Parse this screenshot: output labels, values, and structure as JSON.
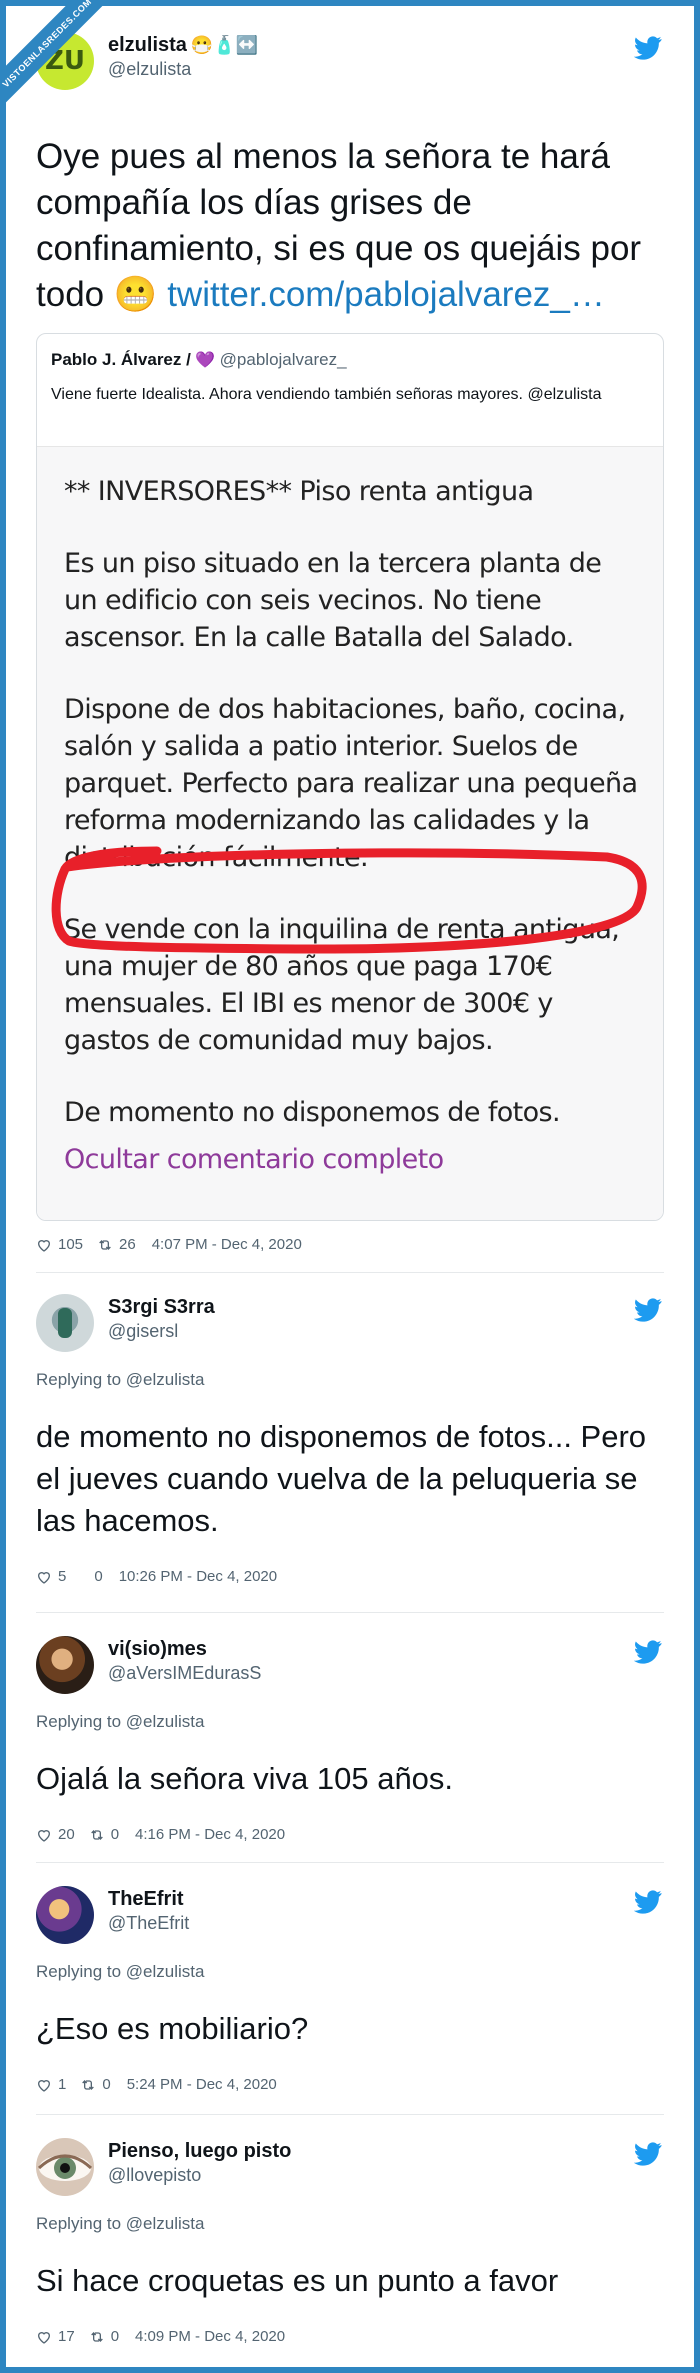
{
  "watermark": "VISTOENLASREDES.COM",
  "main_tweet": {
    "display_name": "elzulista",
    "name_emojis": "😷🧴↔️",
    "handle": "@elzulista",
    "avatar_text": "ZU",
    "text": "Oye pues al menos la señora te hará compañía los días grises de confinamiento, si es que os quejáis por todo",
    "text_emoji": "😬",
    "link": "twitter.com/pablojalvarez_…",
    "likes": "105",
    "retweets": "26",
    "timestamp": "4:07 PM - Dec 4, 2020"
  },
  "quote": {
    "display_name": "Pablo J. Álvarez /",
    "name_emoji": "💜",
    "handle": "@pablojalvarez_",
    "text": "Viene fuerte Idealista. Ahora vendiendo también señoras mayores. @elzulista",
    "ad_paragraphs": [
      "** INVERSORES** Piso renta antigua",
      "Es un piso situado en la tercera planta de un edificio con seis vecinos. No tiene ascensor. En la calle Batalla del Salado.",
      "Dispone de dos habitaciones, baño, cocina, salón y salida a patio interior. Suelos de parquet. Perfecto para realizar una pequeña reforma modernizando las calidades y la distribución fácilmente.",
      "Se vende con la inquilina de renta antigua, una mujer de 80 años que paga 170€ mensuales. El IBI es menor de 300€ y gastos de comunidad muy bajos.",
      "De momento no disponemos de fotos."
    ],
    "hide_link": "Ocultar comentario completo",
    "highlight_color": "#e8202a"
  },
  "replies": [
    {
      "display_name": "S3rgi S3rra",
      "handle": "@gisersl",
      "replying_to": "Replying to @elzulista",
      "text": "de momento no disponemos de fotos... Pero el jueves cuando vuelva de la peluqueria se las hacemos.",
      "likes": "5",
      "retweets": "0",
      "timestamp": "10:26 PM - Dec 4, 2020"
    },
    {
      "display_name": "vi(sio)mes",
      "handle": "@aVersIMEdurasS",
      "replying_to": "Replying to @elzulista",
      "text": "Ojalá la señora viva 105 años.",
      "likes": "20",
      "retweets": "0",
      "timestamp": "4:16 PM - Dec 4, 2020"
    },
    {
      "display_name": "TheEfrit",
      "handle": "@TheEfrit",
      "replying_to": "Replying to @elzulista",
      "text": "¿Eso es mobiliario?",
      "likes": "1",
      "retweets": "0",
      "timestamp": "5:24 PM - Dec 4, 2020"
    },
    {
      "display_name": "Pienso, luego pisto",
      "handle": "@llovepisto",
      "replying_to": "Replying to @elzulista",
      "text": "Si hace croquetas es un punto a favor",
      "likes": "17",
      "retweets": "0",
      "timestamp": "4:09 PM - Dec 4, 2020"
    }
  ],
  "colors": {
    "twitter_blue": "#1d9bf0",
    "frame_blue": "#2e86c1",
    "link_blue": "#1b7bbf",
    "hide_purple": "#8e3a9a",
    "zu_lime": "#c6e830"
  }
}
